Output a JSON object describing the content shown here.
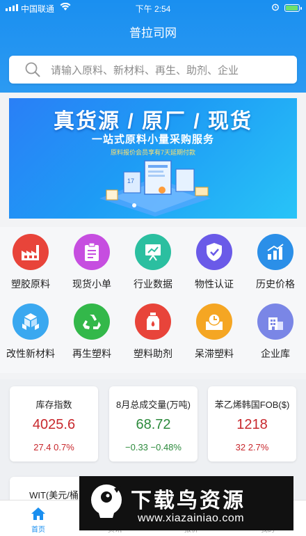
{
  "status_bar": {
    "carrier": "中国联通",
    "time": "下午 2:54"
  },
  "header": {
    "title": "普拉司网"
  },
  "search": {
    "placeholder": "请输入原料、新材料、再生、助剂、企业"
  },
  "banner": {
    "headline": "真货源 / 原厂 / 现货",
    "subline": "一站式原料小量采购服务",
    "note": "原料报价会员享有7天延期付款"
  },
  "grid": {
    "items": [
      {
        "label": "塑胶原料",
        "icon": "factory-icon",
        "color": "#e8443a"
      },
      {
        "label": "现货小单",
        "icon": "clipboard-icon",
        "color": "#c64ee0"
      },
      {
        "label": "行业数据",
        "icon": "presentation-chart-icon",
        "color": "#2bbfa0"
      },
      {
        "label": "物性认证",
        "icon": "shield-check-icon",
        "color": "#6a5ae8"
      },
      {
        "label": "历史价格",
        "icon": "bar-chart-icon",
        "color": "#2b8fe8"
      },
      {
        "label": "改性新材料",
        "icon": "cubes-icon",
        "color": "#3aa8f0"
      },
      {
        "label": "再生塑料",
        "icon": "recycle-icon",
        "color": "#33b84a"
      },
      {
        "label": "塑料助剂",
        "icon": "bottle-icon",
        "color": "#e8443a"
      },
      {
        "label": "呆滞塑料",
        "icon": "clock-box-icon",
        "color": "#f5a623"
      },
      {
        "label": "企业库",
        "icon": "building-icon",
        "color": "#7a86e6"
      }
    ]
  },
  "market_cards": [
    {
      "title": "库存指数",
      "value": "4025.6",
      "change": "27.4  0.7%",
      "trend": "up"
    },
    {
      "title": "8月总成交量(万吨)",
      "value": "68.72",
      "change": "−0.33  −0.48%",
      "trend": "down"
    },
    {
      "title": "苯乙烯韩国FOB($)",
      "value": "1218",
      "change": "32  2.7%",
      "trend": "up"
    }
  ],
  "partial_card": {
    "title": "WIT(美元/桶"
  },
  "tab_bar": {
    "tabs": [
      {
        "label": "首页",
        "icon": "home-icon",
        "active": true
      },
      {
        "label": "资讯",
        "icon": "news-icon",
        "active": false
      },
      {
        "label": "报价",
        "icon": "quote-icon",
        "active": false
      },
      {
        "label": "我的",
        "icon": "user-icon",
        "active": false
      }
    ]
  },
  "watermark": {
    "logo_text": "下载鸟资源",
    "url": "www.xiazainiao.com"
  },
  "colors": {
    "primary": "#1a8ff0",
    "up": "#c8282d",
    "down": "#2c8a3c"
  }
}
